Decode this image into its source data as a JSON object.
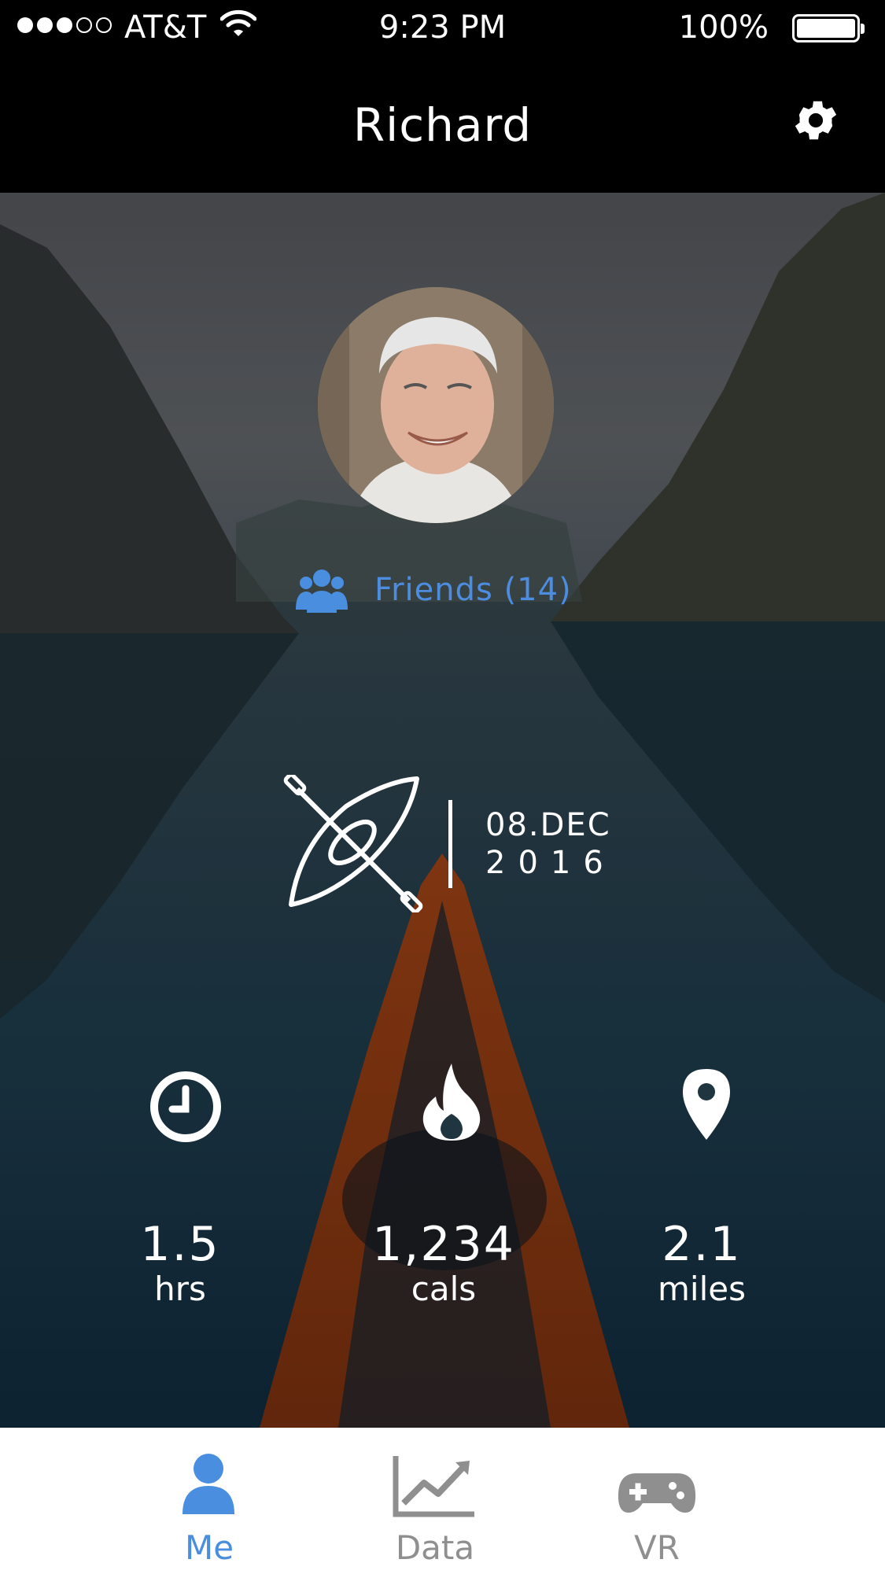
{
  "status_bar": {
    "carrier": "AT&T",
    "signal_bars": 3,
    "signal_total": 5,
    "time": "9:23 PM",
    "battery": "100%",
    "battery_level": 1.0
  },
  "nav": {
    "title": "Richard",
    "settings_icon": "gear-icon"
  },
  "profile": {
    "friends_icon": "users-icon",
    "friends_label": "Friends (14)"
  },
  "activity": {
    "icon": "kayak-icon",
    "date_day": "08.DEC",
    "date_year": "2016"
  },
  "stats": [
    {
      "icon": "clock-icon",
      "value": "1.5",
      "unit": "hrs"
    },
    {
      "icon": "flame-icon",
      "value": "1,234",
      "unit": "cals"
    },
    {
      "icon": "map-pin-icon",
      "value": "2.1",
      "unit": "miles"
    }
  ],
  "tabs": [
    {
      "label": "Me",
      "icon": "person-icon",
      "active": true
    },
    {
      "label": "Data",
      "icon": "line-chart-icon",
      "active": false
    },
    {
      "label": "VR",
      "icon": "gamepad-icon",
      "active": false
    }
  ],
  "colors": {
    "accent": "#4a8ee0",
    "inactive_tab": "#8f8f8f",
    "bar_background": "#000000"
  }
}
